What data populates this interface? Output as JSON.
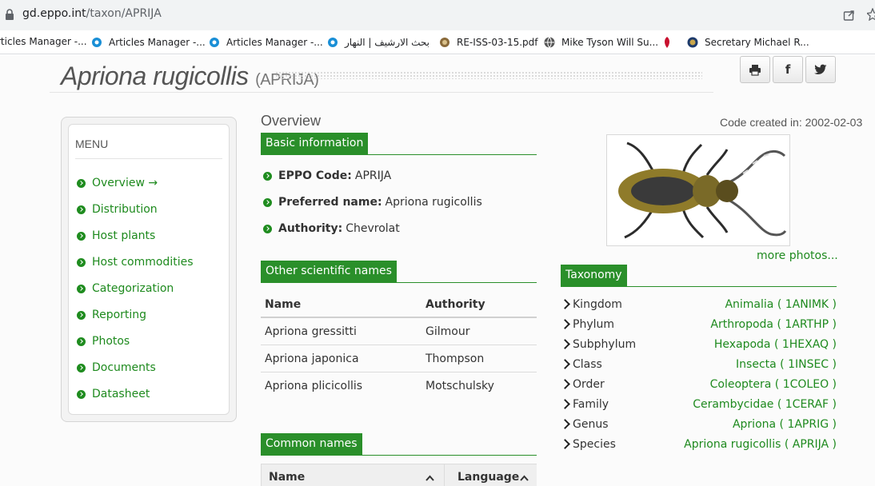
{
  "browser": {
    "url_host": "gd.eppo.int",
    "url_path": "/taxon/APRIJA",
    "bookmarks": [
      {
        "label": "rticles Manager -..."
      },
      {
        "label": "Articles Manager -..."
      },
      {
        "label": "Articles Manager -..."
      },
      {
        "label": "بحث الارشيف | النهار"
      },
      {
        "label": "RE-ISS-03-15.pdf"
      },
      {
        "label": "Mike Tyson Will Su..."
      },
      {
        "label": "Secretary Michael R..."
      }
    ]
  },
  "header": {
    "title": "Apriona rugicollis",
    "code": "(APRIJA)"
  },
  "menu": {
    "title": "MENU",
    "items": [
      {
        "label": "Overview →"
      },
      {
        "label": "Distribution"
      },
      {
        "label": "Host plants"
      },
      {
        "label": "Host commodities"
      },
      {
        "label": "Categorization"
      },
      {
        "label": "Reporting"
      },
      {
        "label": "Photos"
      },
      {
        "label": "Documents"
      },
      {
        "label": "Datasheet"
      }
    ]
  },
  "overview": {
    "heading": "Overview",
    "code_created": "Code created in: 2002-02-03",
    "basic_info_title": "Basic information",
    "basic_info": [
      {
        "label": "EPPO Code:",
        "value": "APRIJA"
      },
      {
        "label": "Preferred name:",
        "value": "Apriona rugicollis"
      },
      {
        "label": "Authority:",
        "value": "Chevrolat"
      }
    ]
  },
  "other_names": {
    "title": "Other scientific names",
    "headers": [
      "Name",
      "Authority"
    ],
    "rows": [
      [
        "Apriona gressitti",
        "Gilmour"
      ],
      [
        "Apriona japonica",
        "Thompson"
      ],
      [
        "Apriona plicicollis",
        "Motschulsky"
      ]
    ]
  },
  "common_names": {
    "title": "Common names",
    "headers": [
      "Name",
      "Language"
    ]
  },
  "photos": {
    "more_label": "more photos..."
  },
  "taxonomy": {
    "title": "Taxonomy",
    "rows": [
      {
        "rank": "Kingdom",
        "value": "Animalia ( 1ANIMK )"
      },
      {
        "rank": "Phylum",
        "value": "Arthropoda ( 1ARTHP )"
      },
      {
        "rank": "Subphylum",
        "value": "Hexapoda ( 1HEXAQ )"
      },
      {
        "rank": "Class",
        "value": "Insecta ( 1INSEC )"
      },
      {
        "rank": "Order",
        "value": "Coleoptera ( 1COLEO )"
      },
      {
        "rank": "Family",
        "value": "Cerambycidae ( 1CERAF )"
      },
      {
        "rank": "Genus",
        "value": "Apriona ( 1APRIG )"
      },
      {
        "rank": "Species",
        "value": "Apriona rugicollis ( APRIJA )"
      }
    ]
  },
  "share": {
    "print_icon": "printer-icon",
    "facebook_label": "f",
    "twitter_icon": "twitter-icon"
  },
  "colors": {
    "accent_green": "#2a8f2a",
    "link_green": "#1e8a1e"
  }
}
